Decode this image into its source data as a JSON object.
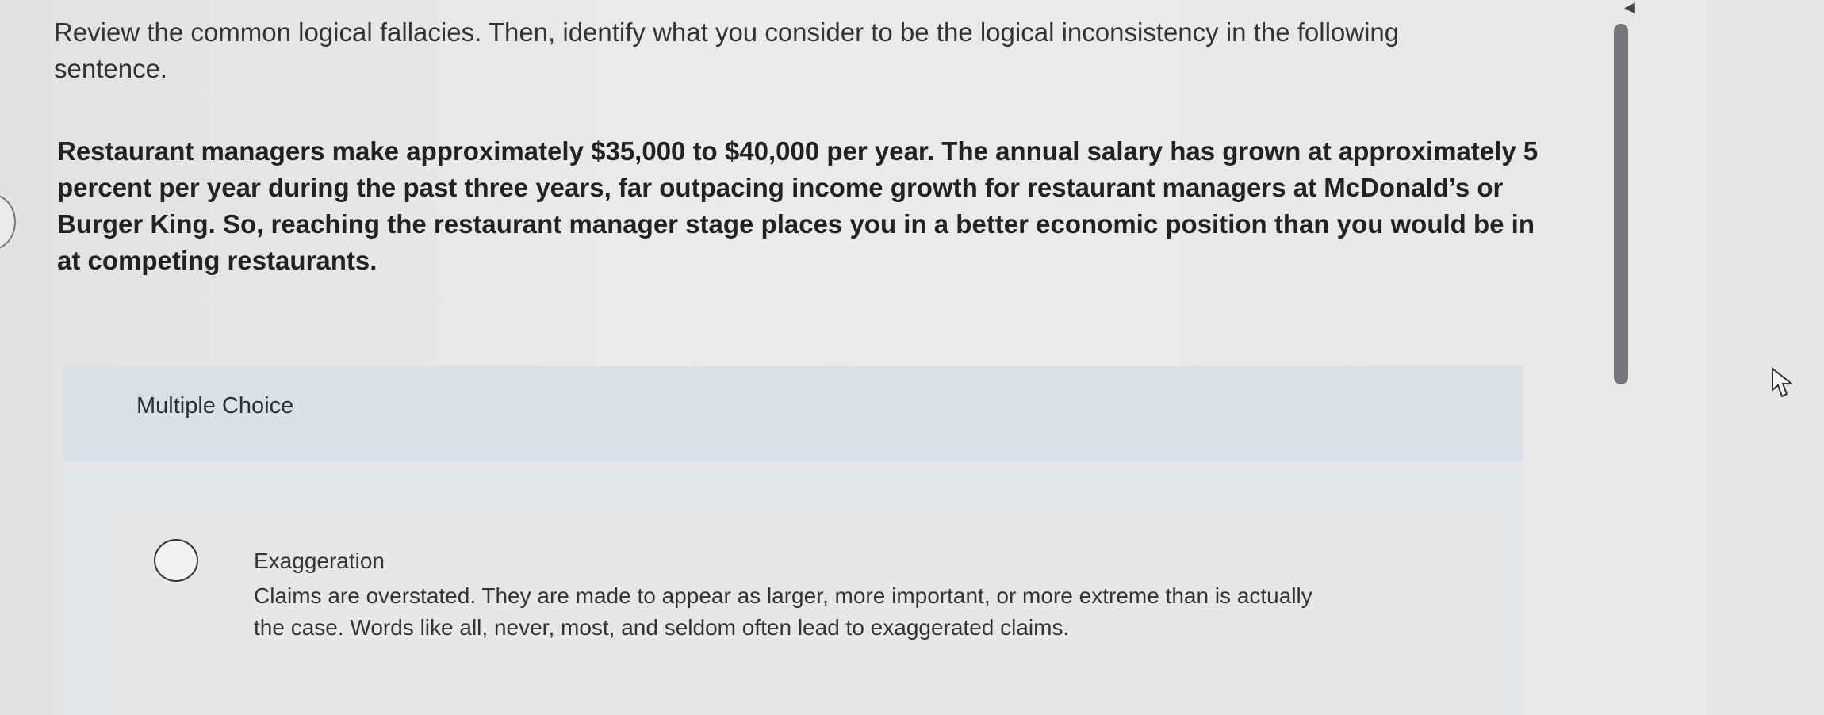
{
  "question": {
    "prompt": "Review the common logical fallacies. Then, identify what you consider to be the logical inconsistency in the following sentence.",
    "passage": "Restaurant managers make approximately $35,000 to $40,000 per year. The annual salary has grown at approximately 5 percent per year during the past three years, far outpacing income growth for restaurant managers at McDonald’s or Burger King. So, reaching the restaurant manager stage places you in a better economic position than you would be in at competing restaurants."
  },
  "multiple_choice": {
    "label": "Multiple Choice",
    "options": [
      {
        "title": "Exaggeration",
        "description": "Claims are overstated. They are made to appear as larger, more important, or more extreme than is actually the case. Words like all, never, most, and seldom often lead to exaggerated claims."
      }
    ]
  },
  "icons": {
    "radio": "radio-button-icon",
    "scroll": "scroll-arrow-icon",
    "cursor": "pointer-cursor-icon"
  }
}
